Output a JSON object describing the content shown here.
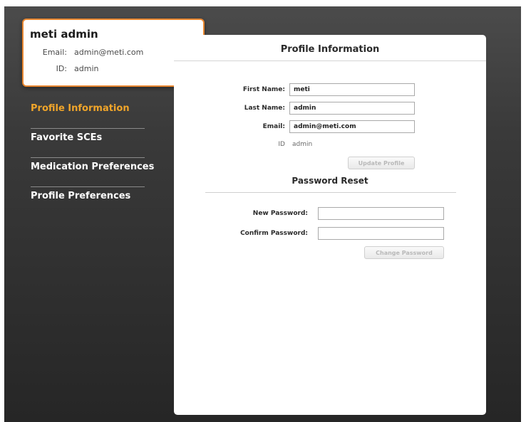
{
  "user_card": {
    "name": "meti admin",
    "email_label": "Email:",
    "email_value": "admin@meti.com",
    "id_label": "ID:",
    "id_value": "admin"
  },
  "nav": {
    "items": [
      {
        "label": "Profile Information",
        "active": true
      },
      {
        "label": "Favorite SCEs",
        "active": false
      },
      {
        "label": "Medication Preferences",
        "active": false
      },
      {
        "label": "Profile Preferences",
        "active": false
      }
    ]
  },
  "profile": {
    "title": "Profile Information",
    "first_name_label": "First Name:",
    "first_name_value": "meti",
    "last_name_label": "Last Name:",
    "last_name_value": "admin",
    "email_label": "Email:",
    "email_value": "admin@meti.com",
    "id_label": "ID",
    "id_value": "admin",
    "update_button": "Update Profile"
  },
  "password": {
    "title": "Password Reset",
    "new_label": "New Password:",
    "new_value": "",
    "confirm_label": "Confirm Password:",
    "confirm_value": "",
    "change_button": "Change Password"
  },
  "colors": {
    "accent": "#f0a52a",
    "card_border": "#e8862f",
    "background_dark": "#2b2b2b"
  }
}
